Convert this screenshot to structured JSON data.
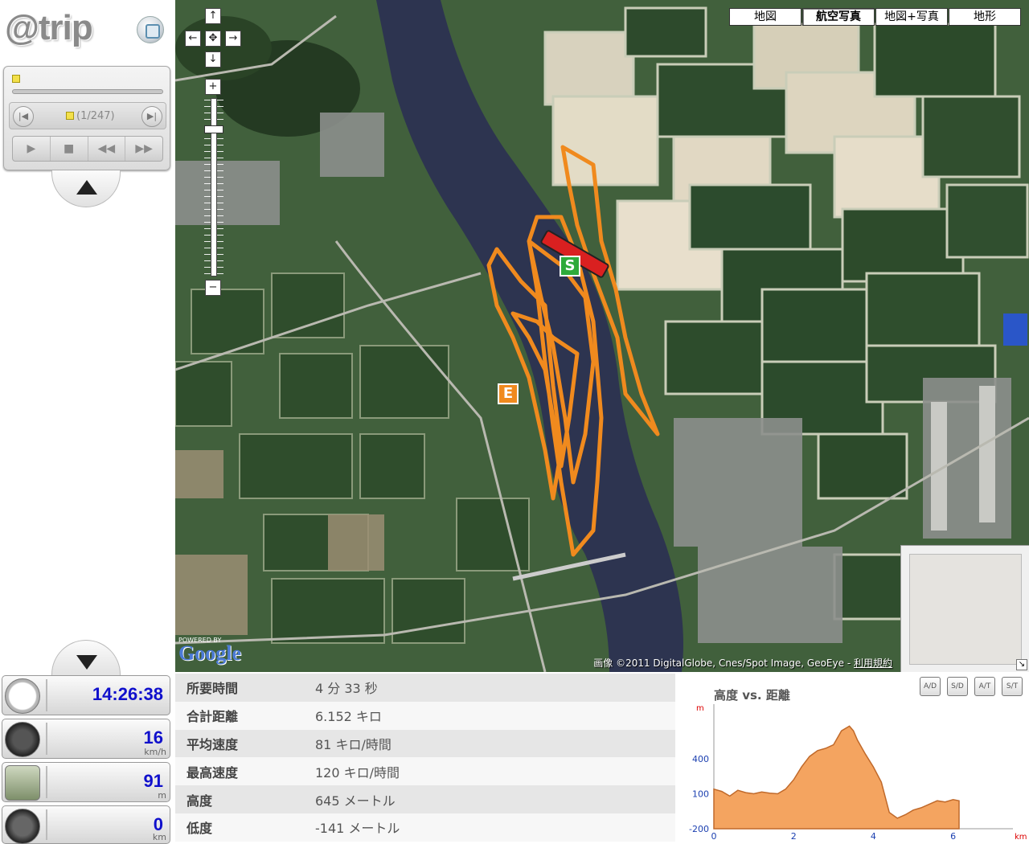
{
  "app": {
    "logo": "@trip"
  },
  "player": {
    "counter": "(1/247)",
    "buttons": [
      "play",
      "stop",
      "rewind",
      "fast-forward"
    ]
  },
  "gauges": [
    {
      "name": "clock",
      "value": "14:26:38",
      "unit": ""
    },
    {
      "name": "speed",
      "value": "16",
      "unit": "km/h"
    },
    {
      "name": "altitude",
      "value": "91",
      "unit": "m"
    },
    {
      "name": "distance",
      "value": "0",
      "unit": "km"
    }
  ],
  "map": {
    "types": [
      "地図",
      "航空写真",
      "地図+写真",
      "地形"
    ],
    "active_type": "航空写真",
    "pan": {
      "up": "↑",
      "left": "←",
      "center": "✥",
      "right": "→",
      "down": "↓"
    },
    "zoom": {
      "in": "+",
      "out": "−"
    },
    "powered_by": "POWERED BY",
    "google_logo": "Google",
    "copyright": "画像 ©2011 DigitalGlobe, Cnes/Spot Image, GeoEye -",
    "terms": "利用規約",
    "start_marker": "S",
    "end_marker": "E",
    "track_color": "#f08a1e"
  },
  "stats": [
    {
      "label": "所要時間",
      "value": "4 分 33 秒"
    },
    {
      "label": "合計距離",
      "value": "6.152 キロ"
    },
    {
      "label": "平均速度",
      "value": "81 キロ/時間"
    },
    {
      "label": "最高速度",
      "value": "120 キロ/時間"
    },
    {
      "label": "高度",
      "value": "645 メートル"
    },
    {
      "label": "低度",
      "value": "-141 メートル"
    }
  ],
  "chart_buttons": [
    "A/D",
    "S/D",
    "A/T",
    "S/T"
  ],
  "chart_data": {
    "type": "area",
    "title": "高度 vs. 距離",
    "y_unit": "m",
    "x_unit": "km",
    "ylim": [
      -200,
      800
    ],
    "xlim": [
      0,
      7.5
    ],
    "y_ticks": [
      400,
      100,
      -200
    ],
    "x_ticks": [
      0,
      2,
      4,
      6
    ],
    "fill_color": "#f4a460",
    "line_color": "#c0692a",
    "x": [
      0,
      0.2,
      0.4,
      0.6,
      0.8,
      1.0,
      1.2,
      1.4,
      1.6,
      1.8,
      2.0,
      2.2,
      2.4,
      2.6,
      2.8,
      3.0,
      3.2,
      3.4,
      3.5,
      3.6,
      3.8,
      4.0,
      4.2,
      4.4,
      4.6,
      4.8,
      5.0,
      5.2,
      5.4,
      5.6,
      5.8,
      6.0,
      6.15
    ],
    "values": [
      140,
      120,
      80,
      130,
      110,
      100,
      115,
      105,
      100,
      140,
      220,
      330,
      420,
      470,
      490,
      520,
      640,
      680,
      640,
      560,
      440,
      330,
      200,
      -60,
      -110,
      -80,
      -40,
      -20,
      10,
      40,
      30,
      50,
      40
    ]
  }
}
